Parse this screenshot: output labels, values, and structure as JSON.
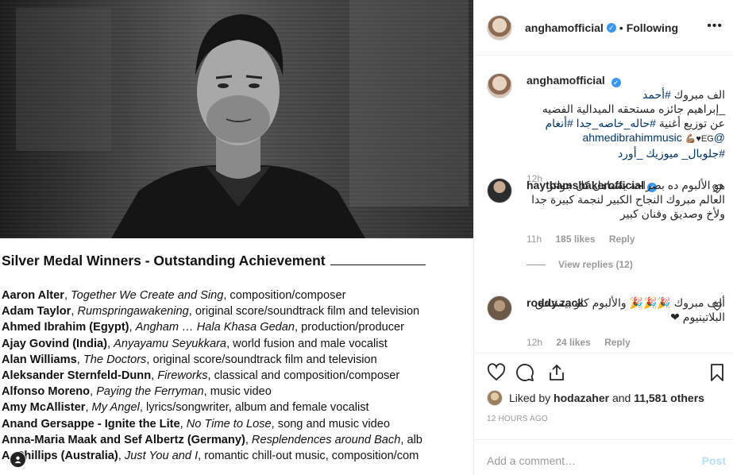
{
  "post": {
    "author": "anghamofficial",
    "follow_status": "Following",
    "dot": "•",
    "more": "•••"
  },
  "image_doc": {
    "title": "Silver Medal Winners - Outstanding Achievement",
    "winners": [
      {
        "name": "Aaron Alter",
        "work": "Together We Create and Sing",
        "category": ", composition/composer"
      },
      {
        "name": "Adam Taylor",
        "work": "Rumspringawakening",
        "category": ", original score/soundtrack film and television"
      },
      {
        "name": "Ahmed Ibrahim (Egypt)",
        "work": "Angham … Hala Khasa Gedan",
        "category": ", production/producer"
      },
      {
        "name": "Ajay Govind (India)",
        "work": "Anyayamu Seyukkara",
        "category": ", world fusion and male vocalist"
      },
      {
        "name": "Alan Williams",
        "work": "The Doctors",
        "category": ", original score/soundtrack film and television"
      },
      {
        "name": "Aleksander Sternfeld-Dunn",
        "work": "Fireworks",
        "category": ", classical and composition/composer"
      },
      {
        "name": "Alfonso Moreno",
        "work": "Paying the Ferryman",
        "category": ", music video"
      },
      {
        "name": "Amy McAllister",
        "work": "My Angel",
        "category": ", lyrics/songwriter, album and female vocalist"
      },
      {
        "name": "Anand Gersappe - Ignite the Lite",
        "work": "No Time to Lose",
        "category": ", song and music video"
      },
      {
        "name": "Anna-Maria Maak and Sef Albertz (Germany)",
        "work": "Resplendences around Bach",
        "category": ", alb"
      },
      {
        "name": "A. Phillips (Australia)",
        "work": "Just You and I",
        "category": ", romantic chill-out music, composition/com"
      }
    ]
  },
  "caption": {
    "user": "anghamofficial",
    "line1": "الف مبروك ",
    "tag1": "#أحمد",
    "line2": "_إبراهيم جائزه مستحقه الميدالية الفضيه",
    "line3a": "عن توزيع أغنية ",
    "tag2": "#حاله_خاصه_جدا",
    "tag3": "#أنغام",
    "mention": "@ahmedibrahimmusic",
    "flex": "💪🏽♥EG",
    "tag4": "#جلوبال_ ميوزيك _أورد",
    "time": "12h"
  },
  "comments": [
    {
      "user": "haythamshakerofficial",
      "text": "هو الألبوم ده بصراحة يستاهل كل جوائز العالم مبروك النجاح الكبير لنجمة كبيرة جدا ولأخ وصديق وفنان كبير",
      "time": "11h",
      "likes": "185 likes",
      "reply": "Reply",
      "view_replies": "View replies (12)"
    },
    {
      "user": "roddy.zack",
      "text": "ألف مبروك 🎉🎉🎉 والألبوم كلو بيستحق البلاتينيوم ❤",
      "time": "12h",
      "likes": "24 likes",
      "reply": "Reply"
    }
  ],
  "actions": {
    "liked_by_prefix": "Liked by ",
    "liked_by_user": "hodazaher",
    "liked_by_mid": " and ",
    "liked_by_count": "11,581 others",
    "ago": "12 HOURS AGO",
    "comment_placeholder": "Add a comment…",
    "post_label": "Post"
  },
  "colors": {
    "accent": "#3897f0",
    "link": "#003569",
    "muted": "#999999",
    "post_disabled": "#b2dffc"
  },
  "icons": [
    "heart-icon",
    "comment-icon",
    "share-icon",
    "bookmark-icon",
    "verified-icon",
    "more-icon"
  ]
}
